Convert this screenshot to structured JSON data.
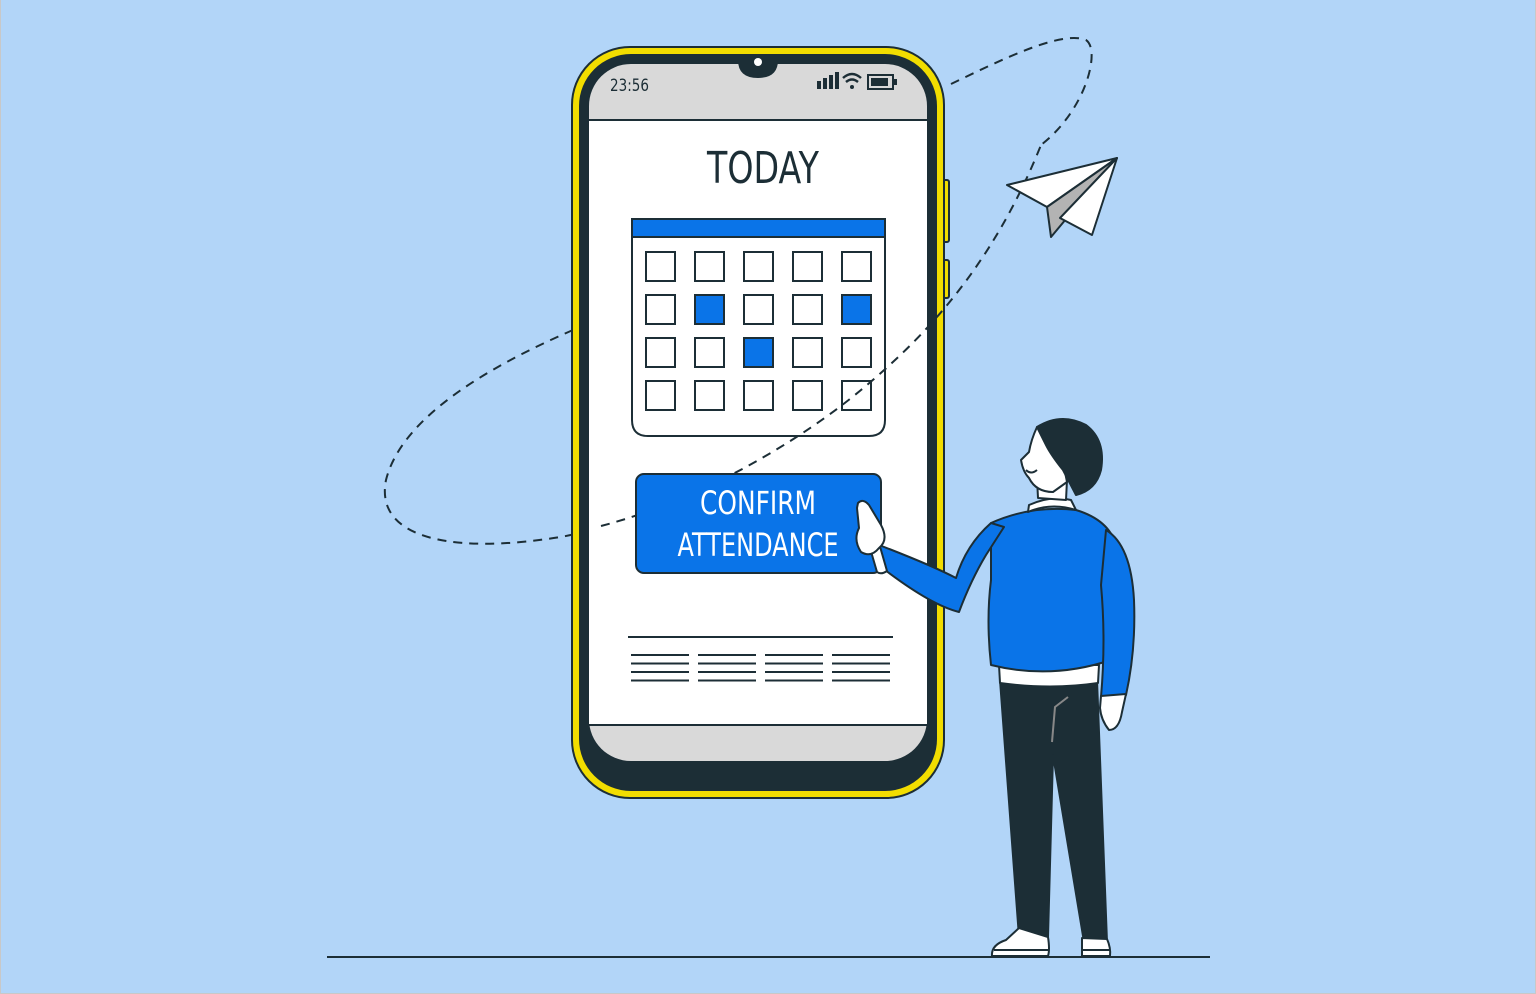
{
  "colors": {
    "background": "#b2d5f8",
    "phone_frame": "#f2dd00",
    "phone_body": "#1c2e36",
    "screen_bar": "#d9d9d9",
    "screen": "#ffffff",
    "accent_blue": "#0a74e8",
    "outline": "#1c2e36"
  },
  "status_bar": {
    "time": "23:56",
    "icons": [
      "signal-icon",
      "wifi-icon",
      "battery-icon"
    ]
  },
  "screen": {
    "title": "TODAY",
    "calendar": {
      "rows": 4,
      "cols": 5,
      "highlighted": [
        [
          1,
          1
        ],
        [
          1,
          4
        ],
        [
          2,
          2
        ]
      ]
    },
    "button": {
      "line1": "CONFIRM",
      "line2": "ATTENDANCE"
    },
    "text_placeholder_columns": 4,
    "text_placeholder_lines_per_column": 4
  },
  "decorations": [
    "paper-plane",
    "dashed-orbit",
    "ground-line",
    "person-pointing"
  ]
}
